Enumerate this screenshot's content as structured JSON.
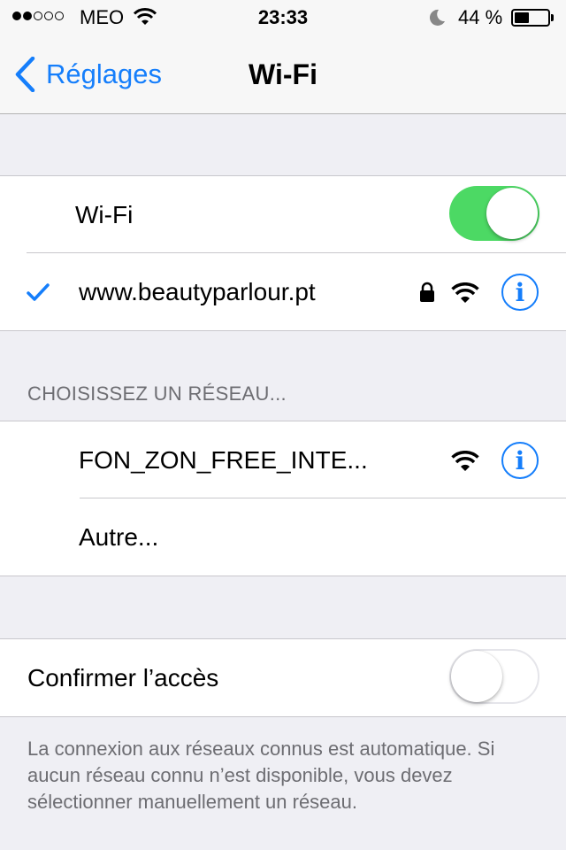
{
  "status_bar": {
    "signal_dots_filled": 2,
    "signal_dots_total": 5,
    "carrier": "MEO",
    "time": "23:33",
    "battery_percent_label": "44 %",
    "battery_level": 0.44
  },
  "nav": {
    "back_label": "Réglages",
    "title": "Wi-Fi"
  },
  "wifi_group": {
    "toggle_label": "Wi-Fi",
    "toggle_on": true,
    "connected_network": "www.beautyparlour.pt"
  },
  "networks": {
    "header": "CHOISISSEZ UN RÉSEAU...",
    "items": [
      {
        "name": "FON_ZON_FREE_INTE..."
      }
    ],
    "other_label": "Autre..."
  },
  "ask_to_join": {
    "label": "Confirmer l’accès",
    "toggle_on": false,
    "footer": "La connexion aux réseaux connus est automatique. Si aucun réseau connu n’est disponible, vous devez sélectionner manuellement un réseau."
  },
  "icons": {
    "info_glyph": "i"
  },
  "colors": {
    "accent": "#157efb",
    "toggle_on": "#4cd964",
    "background": "#efeff4",
    "secondary_text": "#6d6d72"
  }
}
